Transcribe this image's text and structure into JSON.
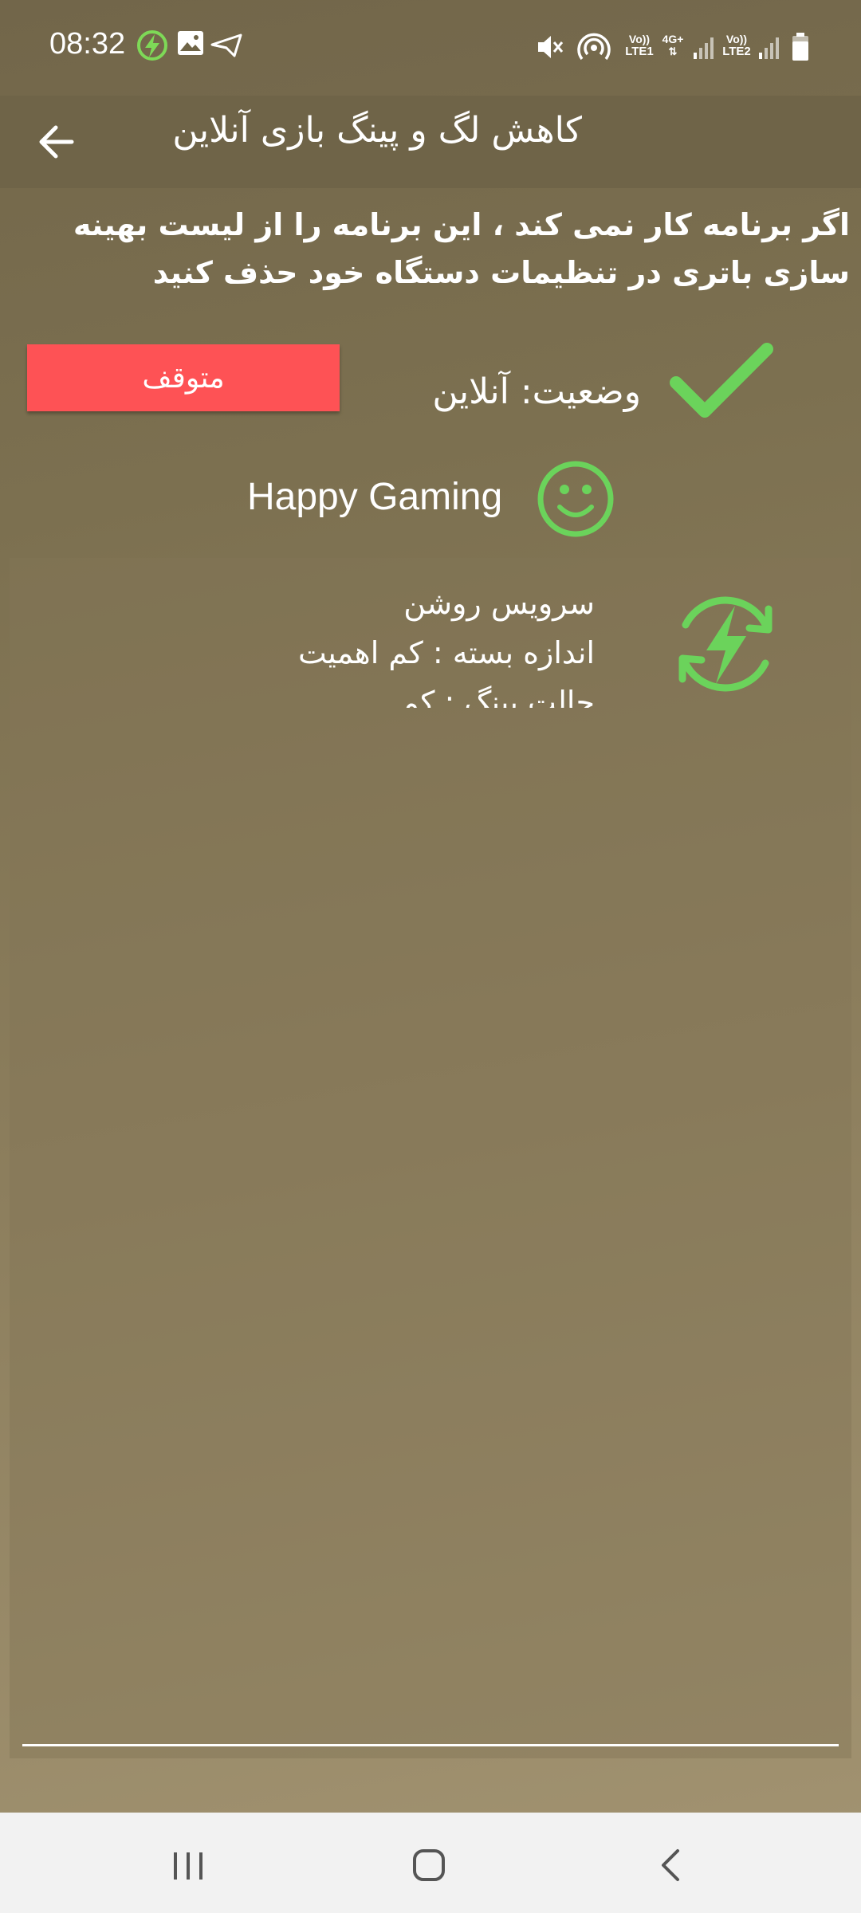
{
  "status_bar": {
    "time": "08:32",
    "left_icons": [
      "lightning-sync-icon",
      "image-icon",
      "telegram-icon"
    ],
    "right_icons": [
      "mute-icon",
      "hotspot-icon",
      "volte-lte1-icon",
      "4g-plus-icon",
      "signal1-icon",
      "volte-lte2-icon",
      "signal2-icon",
      "battery-icon"
    ],
    "lte1_label": "LTE1",
    "lte2_label": "LTE2",
    "net_label": "4G+",
    "volte_label": "Vo))"
  },
  "app_bar": {
    "title": "کاهش لگ و پینگ بازی آنلاین",
    "back_icon": "arrow-back-icon"
  },
  "notice": "اگر برنامه کار نمی کند ، این برنامه را از لیست بهینه سازی باتری در تنظیمات دستگاه خود حذف کنید",
  "status": {
    "label": "وضعیت: آنلاین",
    "icon": "checkmark-icon",
    "color": "#6bd35b"
  },
  "stop_button": {
    "label": "متوقف",
    "color": "#fe5255"
  },
  "greeting": {
    "text": "Happy Gaming",
    "icon": "smiley-icon"
  },
  "log": {
    "lines": [
      "سرویس روشن",
      "اندازه بسته : کم اهمیت",
      "حالت پینگ : کم"
    ],
    "icon": "lightning-sync-icon"
  },
  "nav_bar": {
    "icons": [
      "recent-apps-icon",
      "home-icon",
      "back-nav-icon"
    ]
  }
}
